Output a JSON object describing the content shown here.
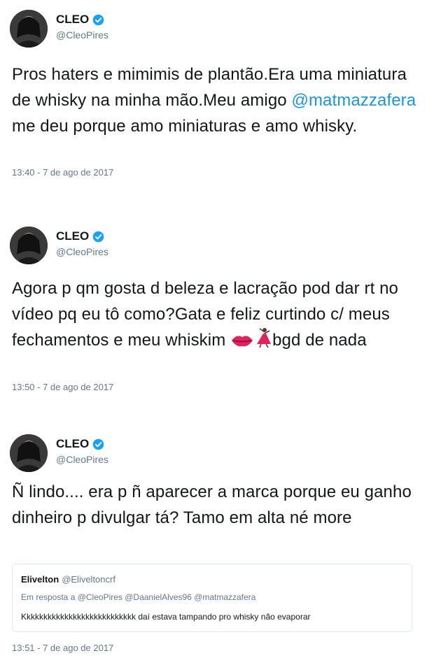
{
  "tweets": [
    {
      "name": "CLEO",
      "handle": "@CleoPires",
      "text_before": "Pros haters e mimimis de plantão.Era uma miniatura de whisky na minha mão.Meu amigo ",
      "mention": "@matmazzafera",
      "text_after": " me deu porque amo miniaturas e amo whisky.",
      "timestamp": "13:40 - 7 de ago de 2017"
    },
    {
      "name": "CLEO",
      "handle": "@CleoPires",
      "text": "Agora p qm gosta d beleza e lacração pod dar rt no vídeo pq eu tô como?Gata e feliz curtindo c/ meus fechamentos e meu whiskim",
      "emojis": [
        "kiss-lips-icon",
        "dancer-icon"
      ],
      "text_end": "bgd de nada",
      "timestamp": "13:50 - 7 de ago de 2017"
    },
    {
      "name": "CLEO",
      "handle": "@CleoPires",
      "text": "Ñ lindo.... era p ñ aparecer a marca porque eu ganho dinheiro p divulgar tá? Tamo em alta né more",
      "timestamp": "13:51 - 7 de ago de 2017",
      "quote": {
        "name": "Elivelton",
        "handle": "@Eliveltoncrf",
        "reply_to": "Em resposta a @CleoPires @DaanielAlves96 @matmazzafera",
        "text": "Kkkkkkkkkkkkkkkkkkkkkkkkkkk daí estava tampando pro whisky não evaporar"
      }
    }
  ],
  "colors": {
    "mention": "#1b95e0",
    "verified": "#1da1f2",
    "secondary_text": "#657786"
  }
}
